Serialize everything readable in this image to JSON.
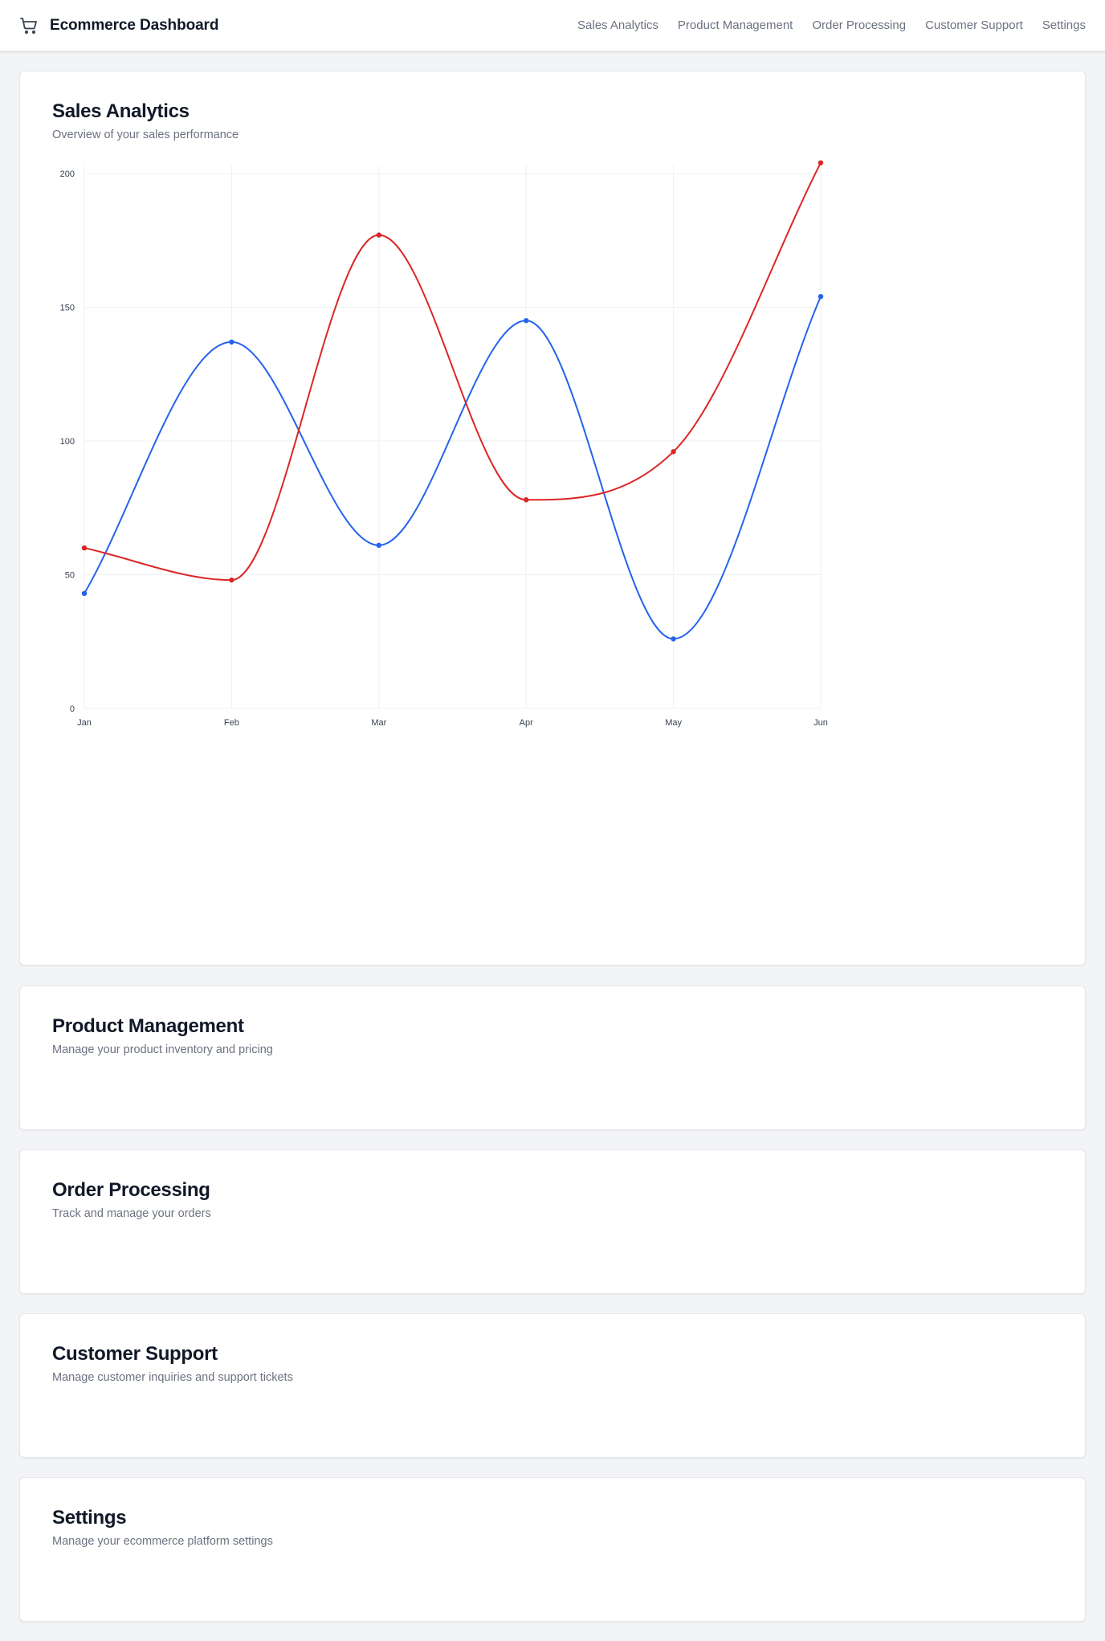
{
  "app": {
    "title": "Ecommerce Dashboard",
    "icon": "shopping-cart-icon"
  },
  "nav": [
    {
      "label": "Sales Analytics"
    },
    {
      "label": "Product Management"
    },
    {
      "label": "Order Processing"
    },
    {
      "label": "Customer Support"
    },
    {
      "label": "Settings"
    }
  ],
  "sections": {
    "sales": {
      "title": "Sales Analytics",
      "subtitle": "Overview of your sales performance"
    },
    "product": {
      "title": "Product Management",
      "subtitle": "Manage your product inventory and pricing"
    },
    "orders": {
      "title": "Order Processing",
      "subtitle": "Track and manage your orders"
    },
    "support": {
      "title": "Customer Support",
      "subtitle": "Manage customer inquiries and support tickets"
    },
    "settings": {
      "title": "Settings",
      "subtitle": "Manage your ecommerce platform settings"
    }
  },
  "chart_data": {
    "type": "line",
    "title": "",
    "xlabel": "",
    "ylabel": "",
    "categories": [
      "Jan",
      "Feb",
      "Mar",
      "Apr",
      "May",
      "Jun"
    ],
    "ylim": [
      0,
      200
    ],
    "yticks": [
      0,
      50,
      100,
      150,
      200
    ],
    "grid": true,
    "curve": "smooth",
    "series": [
      {
        "color": "#2563eb",
        "values": [
          43,
          137,
          61,
          145,
          26,
          154
        ]
      },
      {
        "color": "#dc2626",
        "values": [
          60,
          48,
          177,
          78,
          96,
          204
        ]
      }
    ]
  }
}
